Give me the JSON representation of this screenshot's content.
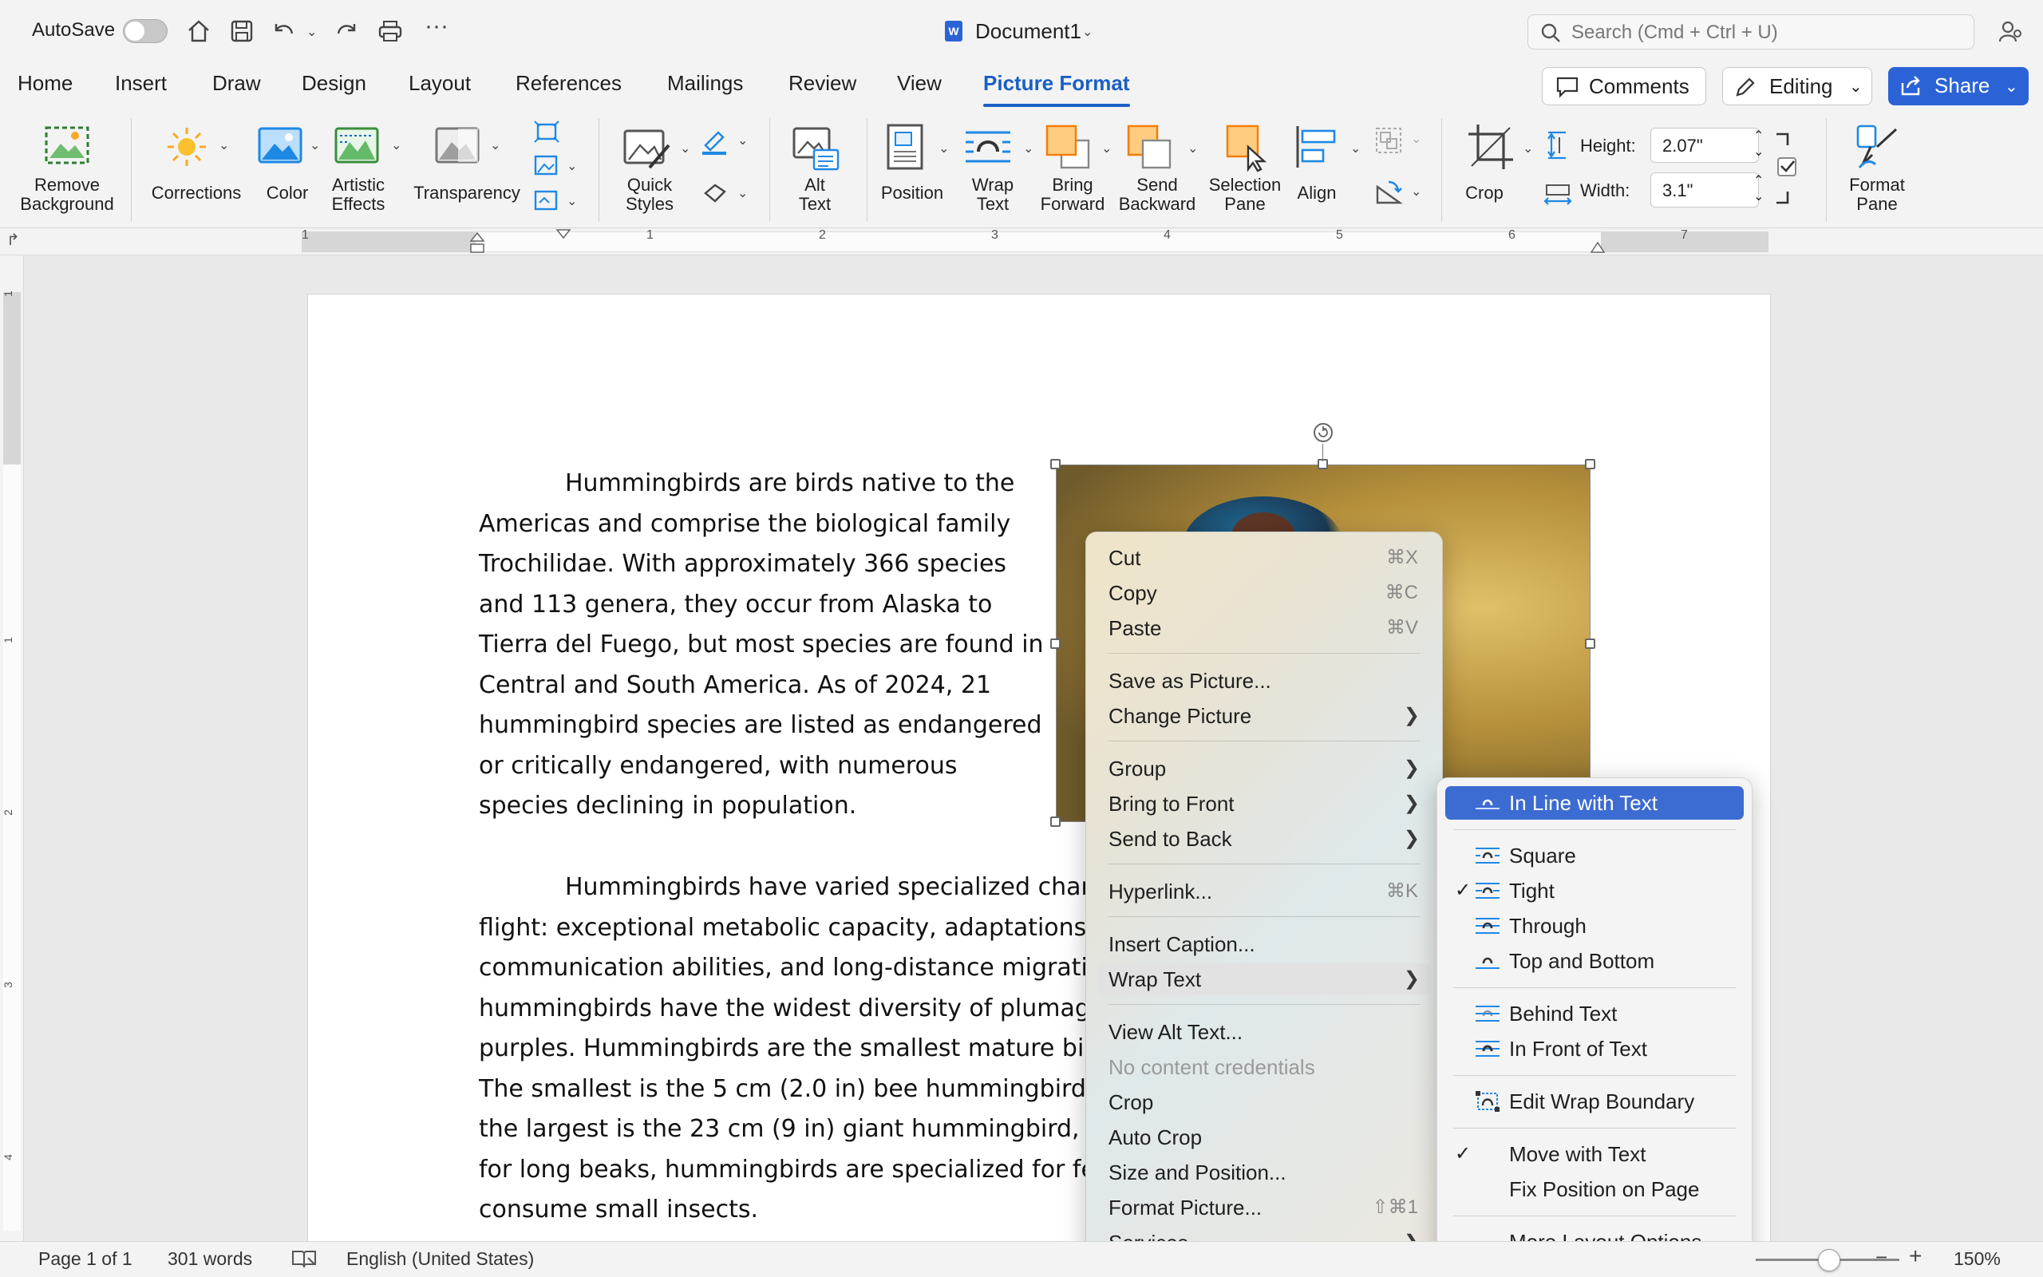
{
  "titlebar": {
    "autosave_label": "AutoSave",
    "document_title": "Document1",
    "search_placeholder": "Search (Cmd + Ctrl + U)"
  },
  "tabs": [
    "Home",
    "Insert",
    "Draw",
    "Design",
    "Layout",
    "References",
    "Mailings",
    "Review",
    "View",
    "Picture Format"
  ],
  "active_tab": "Picture Format",
  "header_buttons": {
    "comments": "Comments",
    "editing": "Editing",
    "share": "Share"
  },
  "ribbon": {
    "remove_background": "Remove\nBackground",
    "corrections": "Corrections",
    "color": "Color",
    "artistic_effects": "Artistic\nEffects",
    "transparency": "Transparency",
    "quick_styles": "Quick\nStyles",
    "alt_text": "Alt\nText",
    "position": "Position",
    "wrap_text": "Wrap\nText",
    "bring_forward": "Bring\nForward",
    "send_backward": "Send\nBackward",
    "selection_pane": "Selection\nPane",
    "align": "Align",
    "crop": "Crop",
    "height_label": "Height:",
    "height_value": "2.07\"",
    "width_label": "Width:",
    "width_value": "3.1\"",
    "format_pane": "Format\nPane"
  },
  "ruler_numbers": [
    "1",
    "1",
    "2",
    "3",
    "4",
    "5",
    "6",
    "7"
  ],
  "vruler_numbers": [
    "1",
    "1",
    "2",
    "3",
    "4"
  ],
  "document": {
    "para1": [
      "Hummingbirds are birds native to the",
      "Americas and comprise the biological family",
      "Trochilidae. With approximately 366 species",
      "and 113 genera, they occur from Alaska to",
      "Tierra del Fuego, but most species are found in",
      "Central and South America. As of 2024, 21",
      "hummingbird species are listed as endangered",
      "or critically endangered, with numerous",
      "species declining in population."
    ],
    "para2": [
      "Hummingbirds have varied specialized charac",
      "flight: exceptional metabolic capacity, adaptations to",
      "communication abilities, and long-distance migratior",
      "hummingbirds have the widest diversity of plumage",
      "purples. Hummingbirds are the smallest mature bird",
      "The smallest is the 5 cm (2.0 in) bee hummingbird, w",
      "the largest is the 23 cm (9 in) giant hummingbird, we",
      "for long beaks, hummingbirds are specialized for fee",
      "consume small insects."
    ]
  },
  "context_menu": [
    {
      "label": "Cut",
      "shortcut": "⌘X"
    },
    {
      "label": "Copy",
      "shortcut": "⌘C"
    },
    {
      "label": "Paste",
      "shortcut": "⌘V"
    },
    {
      "label": "Save as Picture..."
    },
    {
      "label": "Change Picture",
      "submenu": true
    },
    {
      "label": "Group",
      "submenu": true
    },
    {
      "label": "Bring to Front",
      "submenu": true
    },
    {
      "label": "Send to Back",
      "submenu": true
    },
    {
      "label": "Hyperlink...",
      "shortcut": "⌘K"
    },
    {
      "label": "Insert Caption..."
    },
    {
      "label": "Wrap Text",
      "submenu": true
    },
    {
      "label": "View Alt Text..."
    },
    {
      "label": "No content credentials",
      "disabled": true
    },
    {
      "label": "Crop"
    },
    {
      "label": "Auto Crop"
    },
    {
      "label": "Size and Position..."
    },
    {
      "label": "Format Picture...",
      "shortcut": "⇧⌘1"
    },
    {
      "label": "Services",
      "submenu": true
    }
  ],
  "wrap_submenu": [
    {
      "label": "In Line with Text",
      "selected": true
    },
    {
      "label": "Square"
    },
    {
      "label": "Tight",
      "checked": true
    },
    {
      "label": "Through"
    },
    {
      "label": "Top and Bottom"
    },
    {
      "label": "Behind Text"
    },
    {
      "label": "In Front of Text"
    },
    {
      "label": "Edit Wrap Boundary"
    },
    {
      "label": "Move with Text",
      "checked": true
    },
    {
      "label": "Fix Position on Page"
    },
    {
      "label": "More Layout Options..."
    }
  ],
  "check_glyph": "✓",
  "statusbar": {
    "page": "Page 1 of 1",
    "words": "301 words",
    "language": "English (United States)",
    "zoom": "150%"
  },
  "colors": {
    "accent": "#1a5fc4",
    "share_bg": "#2b63d6",
    "selection": "#3c6bd1"
  }
}
